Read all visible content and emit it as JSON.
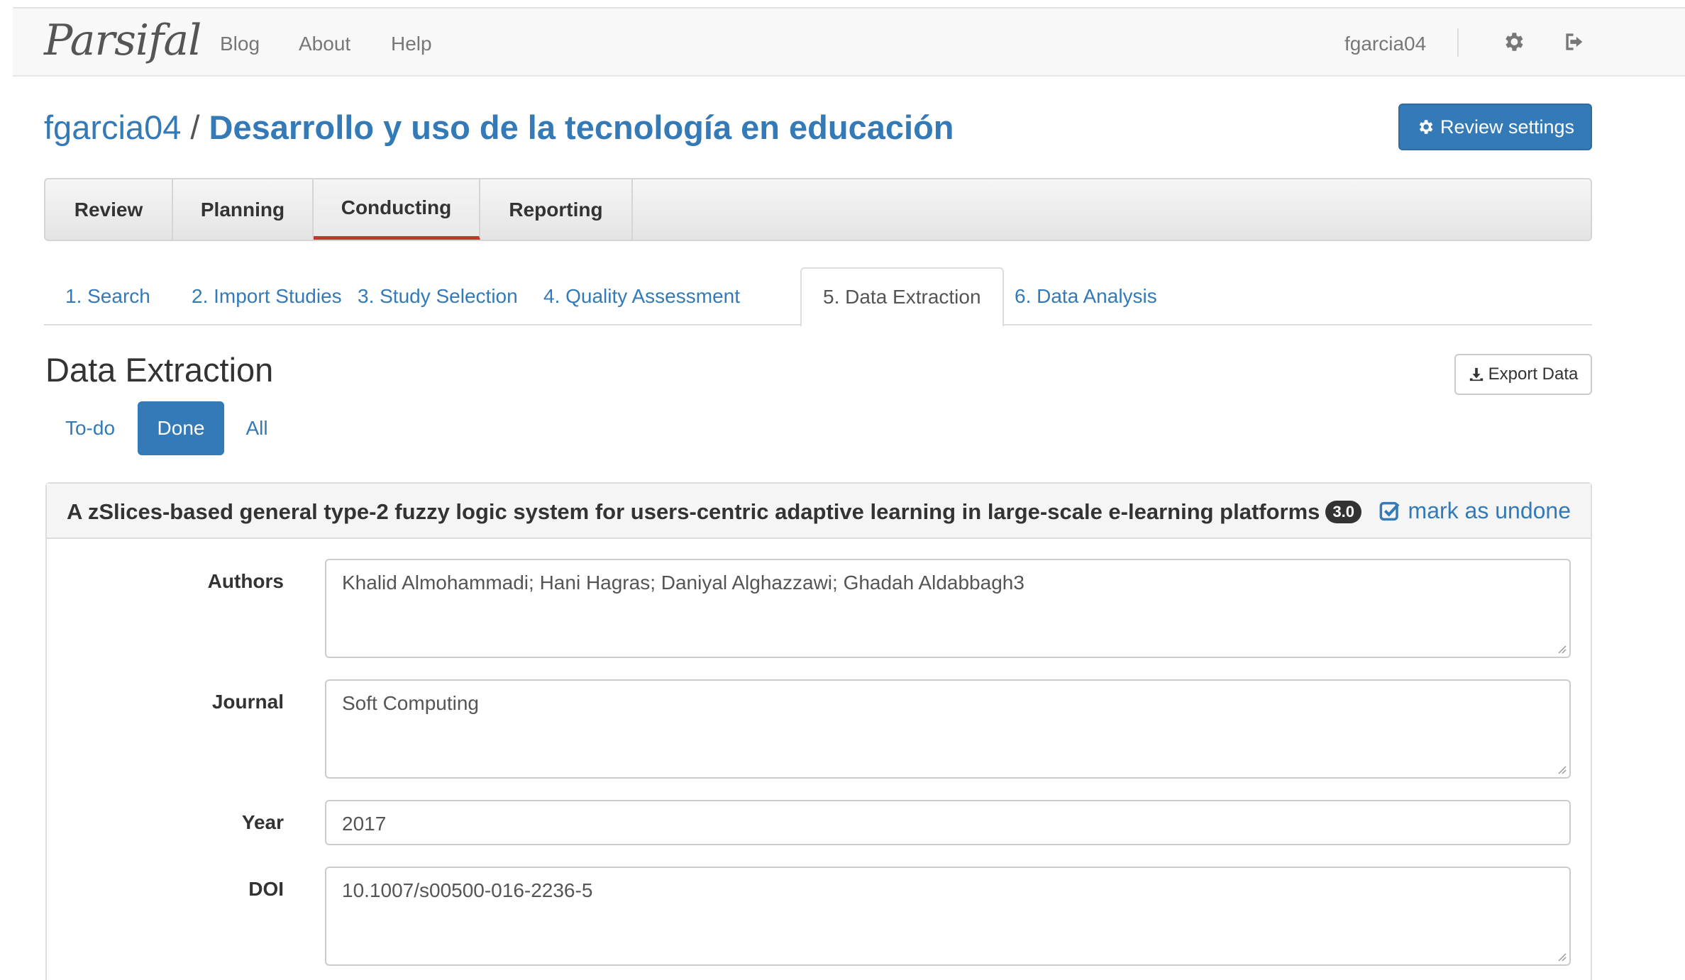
{
  "navbar": {
    "brand": "Parsifal",
    "links": [
      "Blog",
      "About",
      "Help"
    ],
    "username": "fgarcia04"
  },
  "header": {
    "owner": "fgarcia04",
    "separator": "/",
    "review_name": "Desarrollo y uso de la tecnología en educación",
    "settings_button": "Review settings"
  },
  "main_tabs": [
    {
      "label": "Review",
      "active": false
    },
    {
      "label": "Planning",
      "active": false
    },
    {
      "label": "Conducting",
      "active": true
    },
    {
      "label": "Reporting",
      "active": false
    }
  ],
  "sub_tabs": [
    {
      "label": "1. Search"
    },
    {
      "label": "2. Import Studies"
    },
    {
      "label": "3. Study Selection"
    },
    {
      "label": "4. Quality Assessment"
    },
    {
      "label": "5. Data Extraction",
      "active": true
    },
    {
      "label": "6. Data Analysis"
    }
  ],
  "section": {
    "title": "Data Extraction",
    "export_button": "Export Data",
    "filters": [
      "To-do",
      "Done",
      "All"
    ],
    "active_filter": "Done"
  },
  "study": {
    "title": "A zSlices-based general type-2 fuzzy logic system for users-centric adaptive learning in large-scale e-learning platforms",
    "score": "3.0",
    "mark_undone": "mark as undone",
    "fields": {
      "authors_label": "Authors",
      "authors_value": "Khalid Almohammadi; Hani Hagras; Daniyal Alghazzawi; Ghadah Aldabbagh3",
      "journal_label": "Journal",
      "journal_value": "Soft Computing",
      "year_label": "Year",
      "year_value": "2017",
      "doi_label": "DOI",
      "doi_value": "10.1007/s00500-016-2236-5"
    }
  },
  "colors": {
    "primary": "#337ab7",
    "active_tab_underline": "#c0392b",
    "badge": "#333333"
  },
  "icons": [
    "gear-icon",
    "logout-icon",
    "download-icon",
    "check-square-icon"
  ]
}
